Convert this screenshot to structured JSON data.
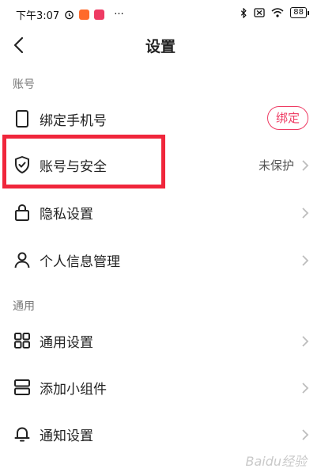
{
  "status": {
    "time": "下午3:07",
    "dots": "···",
    "battery": "88",
    "badge_colors": [
      "#ff6a2b",
      "#ee3b63"
    ]
  },
  "header": {
    "title": "设置"
  },
  "sections": {
    "account": "账号",
    "general": "通用"
  },
  "rows": {
    "bind_phone": {
      "label": "绑定手机号",
      "action": "绑定"
    },
    "account_security": {
      "label": "账号与安全",
      "value": "未保护"
    },
    "privacy": {
      "label": "隐私设置"
    },
    "personal_info": {
      "label": "个人信息管理"
    },
    "general_settings": {
      "label": "通用设置"
    },
    "add_widget": {
      "label": "添加小组件"
    },
    "notification": {
      "label": "通知设置"
    }
  },
  "colors": {
    "accent": "#ee3b63",
    "highlight": "#f0263b"
  },
  "watermark": "Baidu经验"
}
